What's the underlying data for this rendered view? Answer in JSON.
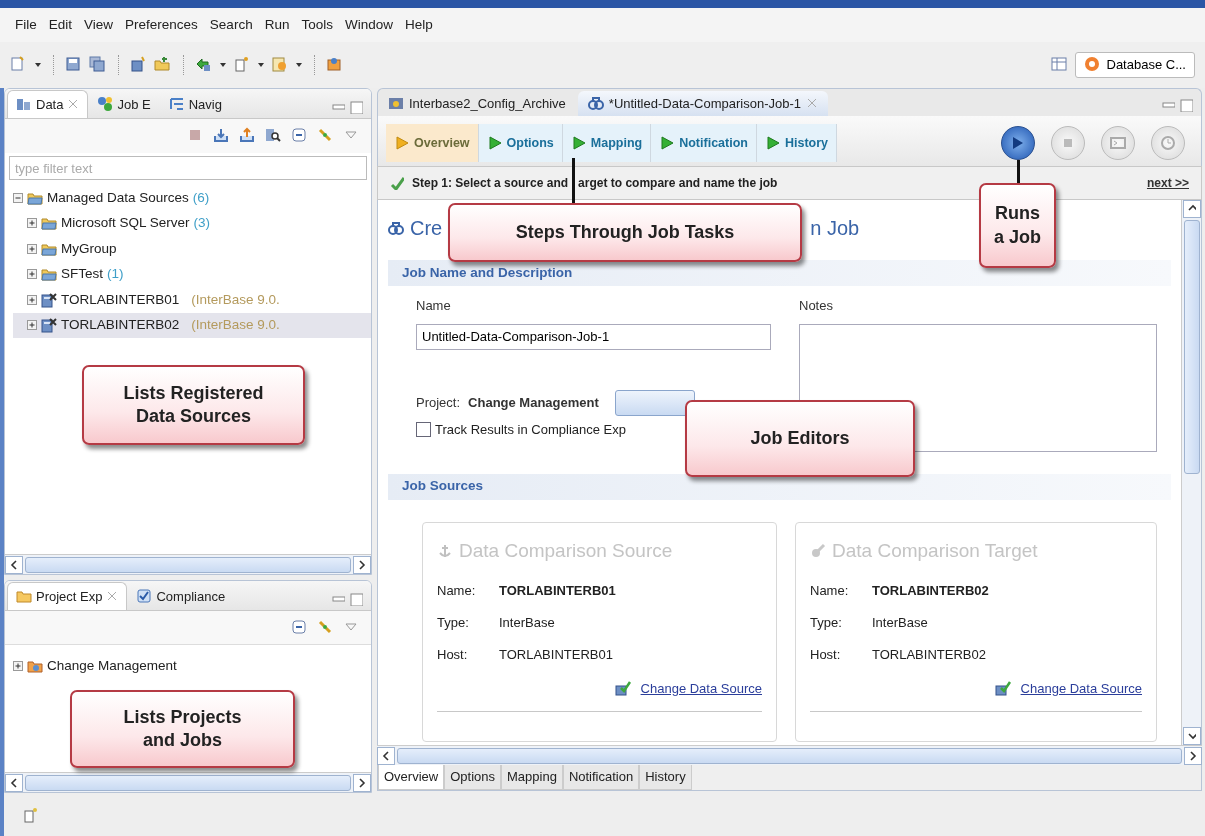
{
  "menu": [
    "File",
    "Edit",
    "View",
    "Preferences",
    "Search",
    "Run",
    "Tools",
    "Window",
    "Help"
  ],
  "perspective": {
    "label": "Database C..."
  },
  "data_panel": {
    "tabs": [
      {
        "label": "Data",
        "selected": true
      },
      {
        "label": "Job E",
        "selected": false
      },
      {
        "label": "Navig",
        "selected": false
      }
    ],
    "filter": {
      "placeholder": "type filter text"
    },
    "tree": [
      {
        "label": "Managed Data Sources",
        "count": "(6)",
        "kind": "folder",
        "expanded": true,
        "selected": false,
        "children": [
          {
            "label": "Microsoft SQL Server",
            "count": "(3)",
            "kind": "folder",
            "expanded": false,
            "selected": false
          },
          {
            "label": "MyGroup",
            "kind": "folder",
            "expanded": false,
            "selected": false
          },
          {
            "label": "SFTest",
            "count": "(1)",
            "kind": "folder",
            "expanded": false,
            "selected": false
          },
          {
            "label": "TORLABINTERB01",
            "detail": "(InterBase 9.0.",
            "kind": "server",
            "expanded": false,
            "selected": false
          },
          {
            "label": "TORLABINTERB02",
            "detail": "(InterBase 9.0.",
            "kind": "server",
            "expanded": false,
            "selected": true
          }
        ]
      }
    ]
  },
  "project_panel": {
    "tabs": [
      {
        "label": "Project Exp",
        "selected": true
      },
      {
        "label": "Compliance",
        "selected": false
      }
    ],
    "tree": [
      {
        "label": "Change Management",
        "kind": "project",
        "expanded": false,
        "selected": false
      }
    ]
  },
  "editor": {
    "tabs": [
      {
        "label": "Interbase2_Config_Archive",
        "selected": false
      },
      {
        "label": "*Untitled-Data-Comparison-Job-1",
        "selected": true
      }
    ],
    "steps": [
      {
        "label": "Overview",
        "selected": true
      },
      {
        "label": "Options",
        "selected": false
      },
      {
        "label": "Mapping",
        "selected": false
      },
      {
        "label": "Notification",
        "selected": false
      },
      {
        "label": "History",
        "selected": false
      }
    ],
    "actions": [
      {
        "kind": "run",
        "disabled": false
      },
      {
        "kind": "stop",
        "disabled": true
      },
      {
        "kind": "console",
        "disabled": true
      },
      {
        "kind": "schedule",
        "disabled": true
      }
    ],
    "step_text": [
      "Step 1: Select a source and",
      "arget to compare and name the job"
    ],
    "next": "next >>",
    "heading": [
      "Cre",
      "n Job"
    ],
    "section1": {
      "title": "Job Name and Description",
      "name_label": "Name",
      "name_value": "Untitled-Data-Comparison-Job-1",
      "notes_label": "Notes",
      "project_label": "Project:",
      "project_value": "Change Management",
      "track": {
        "label": "Track Results in Compliance Exp",
        "checked": false
      }
    },
    "section2": {
      "title": "Job Sources",
      "cards": [
        {
          "kind": "source",
          "title": "Data Comparison Source",
          "fields": [
            {
              "label": "Name:",
              "value": "TORLABINTERB01",
              "bold": true
            },
            {
              "label": "Type:",
              "value": "InterBase",
              "bold": false
            },
            {
              "label": "Host:",
              "value": "TORLABINTERB01",
              "bold": false
            }
          ],
          "link": "Change Data Source"
        },
        {
          "kind": "target",
          "title": "Data Comparison Target",
          "fields": [
            {
              "label": "Name:",
              "value": "TORLABINTERB02",
              "bold": true
            },
            {
              "label": "Type:",
              "value": "InterBase",
              "bold": false
            },
            {
              "label": "Host:",
              "value": "TORLABINTERB02",
              "bold": false
            }
          ],
          "link": "Change Data Source"
        }
      ]
    },
    "bottom_tabs": [
      {
        "label": "Overview",
        "selected": true
      },
      {
        "label": "Options",
        "selected": false
      },
      {
        "label": "Mapping",
        "selected": false
      },
      {
        "label": "Notification",
        "selected": false
      },
      {
        "label": "History",
        "selected": false
      }
    ]
  },
  "callouts": [
    {
      "kind": "steps",
      "lines": [
        "Steps Through Job Tasks"
      ]
    },
    {
      "kind": "run",
      "lines": [
        "Runs",
        "a Job"
      ]
    },
    {
      "kind": "sources",
      "lines": [
        "Lists Registered",
        "Data Sources"
      ]
    },
    {
      "kind": "editors",
      "lines": [
        "Job Editors"
      ]
    },
    {
      "kind": "projects",
      "lines": [
        "Lists Projects",
        "and Jobs"
      ]
    }
  ]
}
